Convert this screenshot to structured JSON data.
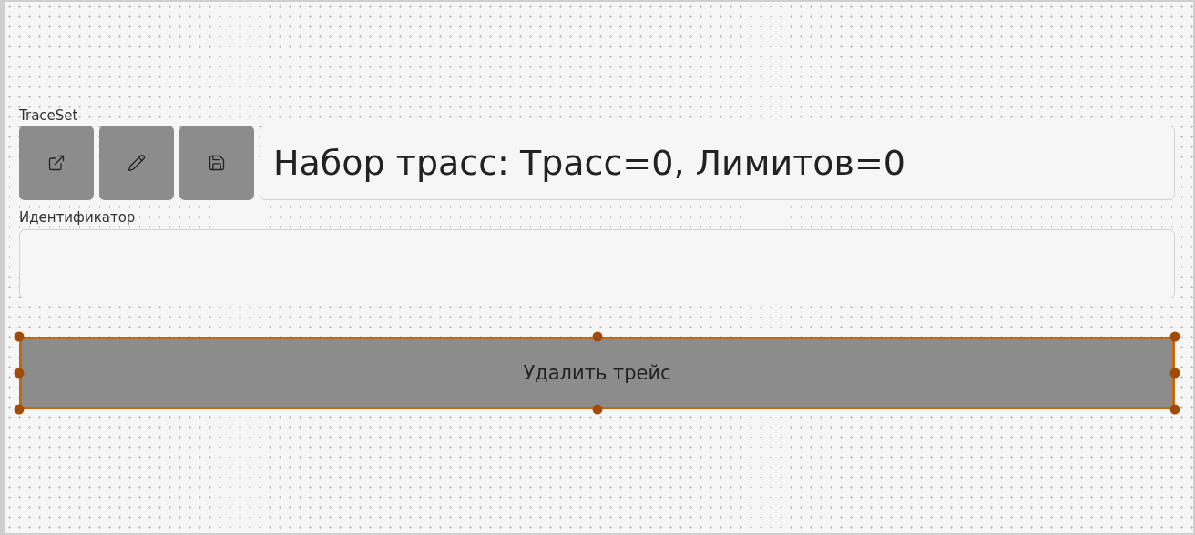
{
  "traceset": {
    "label": "TraceSet",
    "buttons": [
      {
        "kind": "open"
      },
      {
        "kind": "edit"
      },
      {
        "kind": "save"
      }
    ],
    "value": "Набор трасс: Трасс=0, Лимитов=0"
  },
  "identifier": {
    "label": "Идентификатор"
  },
  "delete_button": {
    "label": "Удалить трейс",
    "selected": true
  }
}
